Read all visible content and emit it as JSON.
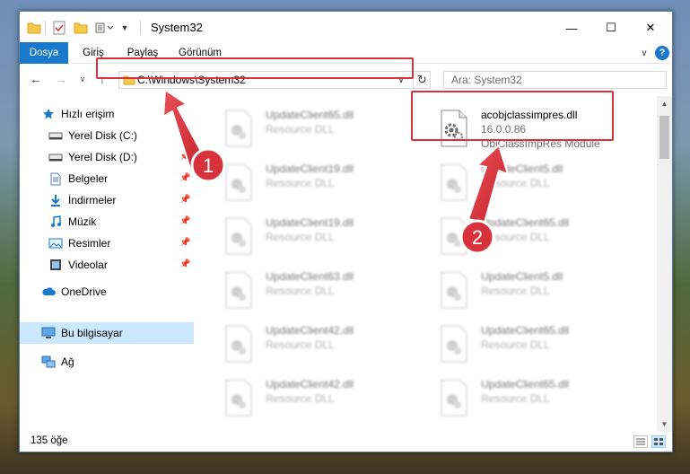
{
  "window": {
    "title": "System32",
    "controls": {
      "minimize": "—",
      "maximize": "☐",
      "close": "✕"
    }
  },
  "ribbon": {
    "tabs": [
      "Dosya",
      "Giriş",
      "Paylaş",
      "Görünüm"
    ],
    "active_tab": "Dosya"
  },
  "nav": {
    "address": "C:\\Windows\\System32",
    "search_placeholder": "Ara: System32"
  },
  "sidebar": {
    "quick_access": "Hızlı erişim",
    "items": [
      {
        "label": "Yerel Disk (C:)",
        "pinned": true
      },
      {
        "label": "Yerel Disk (D:)",
        "pinned": true
      },
      {
        "label": "Belgeler",
        "pinned": true
      },
      {
        "label": "İndirmeler",
        "pinned": true
      },
      {
        "label": "Müzik",
        "pinned": true
      },
      {
        "label": "Resimler",
        "pinned": true
      },
      {
        "label": "Videolar",
        "pinned": true
      }
    ],
    "onedrive": "OneDrive",
    "this_pc": "Bu bilgisayar",
    "network": "Ağ"
  },
  "files": {
    "highlighted": {
      "name": "acobjclassimpres.dll",
      "version": "16.0.0.86",
      "description": "ObjClassImpRes Module"
    },
    "left_column": [
      {
        "name": "UpdateClient65.dll",
        "type": "Resource DLL"
      },
      {
        "name": "UpdateClient19.dll",
        "type": "Resource DLL"
      },
      {
        "name": "UpdateClient19.dll",
        "type": "Resource DLL"
      },
      {
        "name": "UpdateClient63.dll",
        "type": "Resource DLL"
      },
      {
        "name": "UpdateClient42.dll",
        "type": "Resource DLL"
      },
      {
        "name": "UpdateClient42.dll",
        "type": "Resource DLL"
      }
    ],
    "right_column": [
      {
        "name": "UpdateClient5.dll",
        "type": "Resource DLL"
      },
      {
        "name": "UpdateClient65.dll",
        "type": "Resource DLL"
      },
      {
        "name": "UpdateClient5.dll",
        "type": "Resource DLL"
      },
      {
        "name": "UpdateClient65.dll",
        "type": "Resource DLL"
      },
      {
        "name": "UpdateClient65.dll",
        "type": "Resource DLL"
      }
    ]
  },
  "status": {
    "item_count": "135 öğe"
  },
  "annotations": {
    "step1": "1",
    "step2": "2",
    "color": "#d9313b"
  }
}
